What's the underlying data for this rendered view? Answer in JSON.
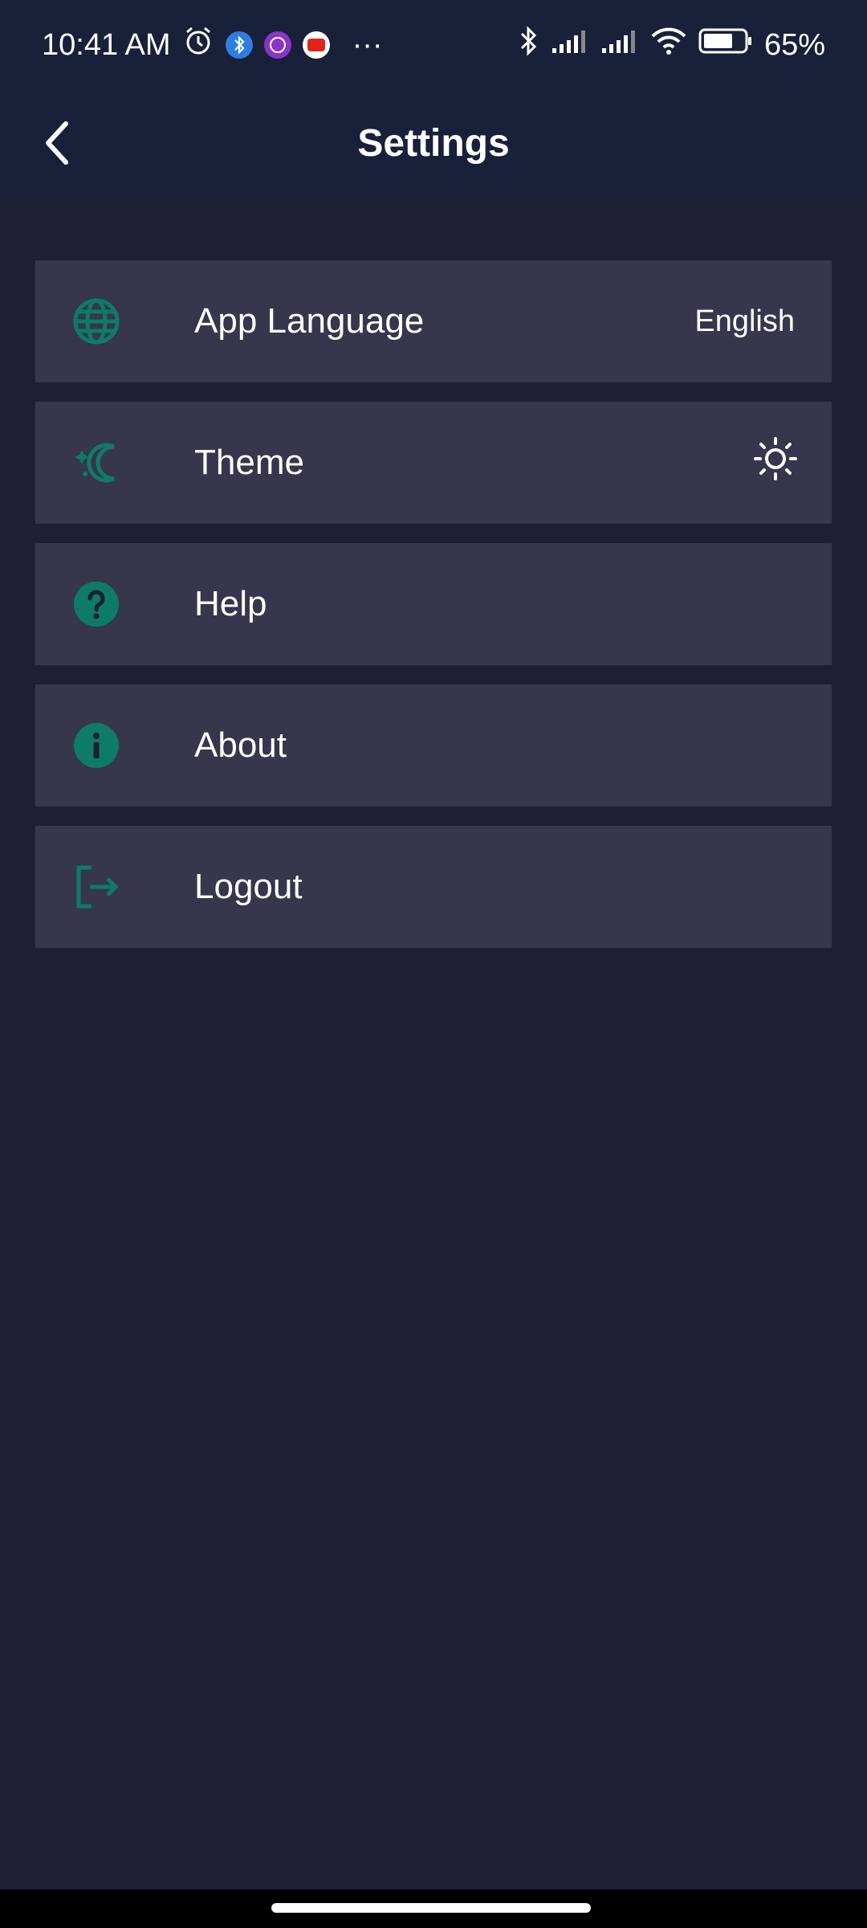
{
  "status_bar": {
    "time": "10:41 AM",
    "more": "···",
    "battery": "65%"
  },
  "header": {
    "title": "Settings"
  },
  "settings": [
    {
      "label": "App Language",
      "value": "English",
      "icon": "globe-icon"
    },
    {
      "label": "Theme",
      "value": "",
      "icon": "theme-icon",
      "trailing_icon": "sun-icon"
    },
    {
      "label": "Help",
      "value": "",
      "icon": "help-icon"
    },
    {
      "label": "About",
      "value": "",
      "icon": "info-icon"
    },
    {
      "label": "Logout",
      "value": "",
      "icon": "logout-icon"
    }
  ],
  "colors": {
    "background": "#1e1e35",
    "header": "#18203a",
    "row": "#36364c",
    "accent": "#0e7a6a",
    "text": "#ffffff"
  }
}
